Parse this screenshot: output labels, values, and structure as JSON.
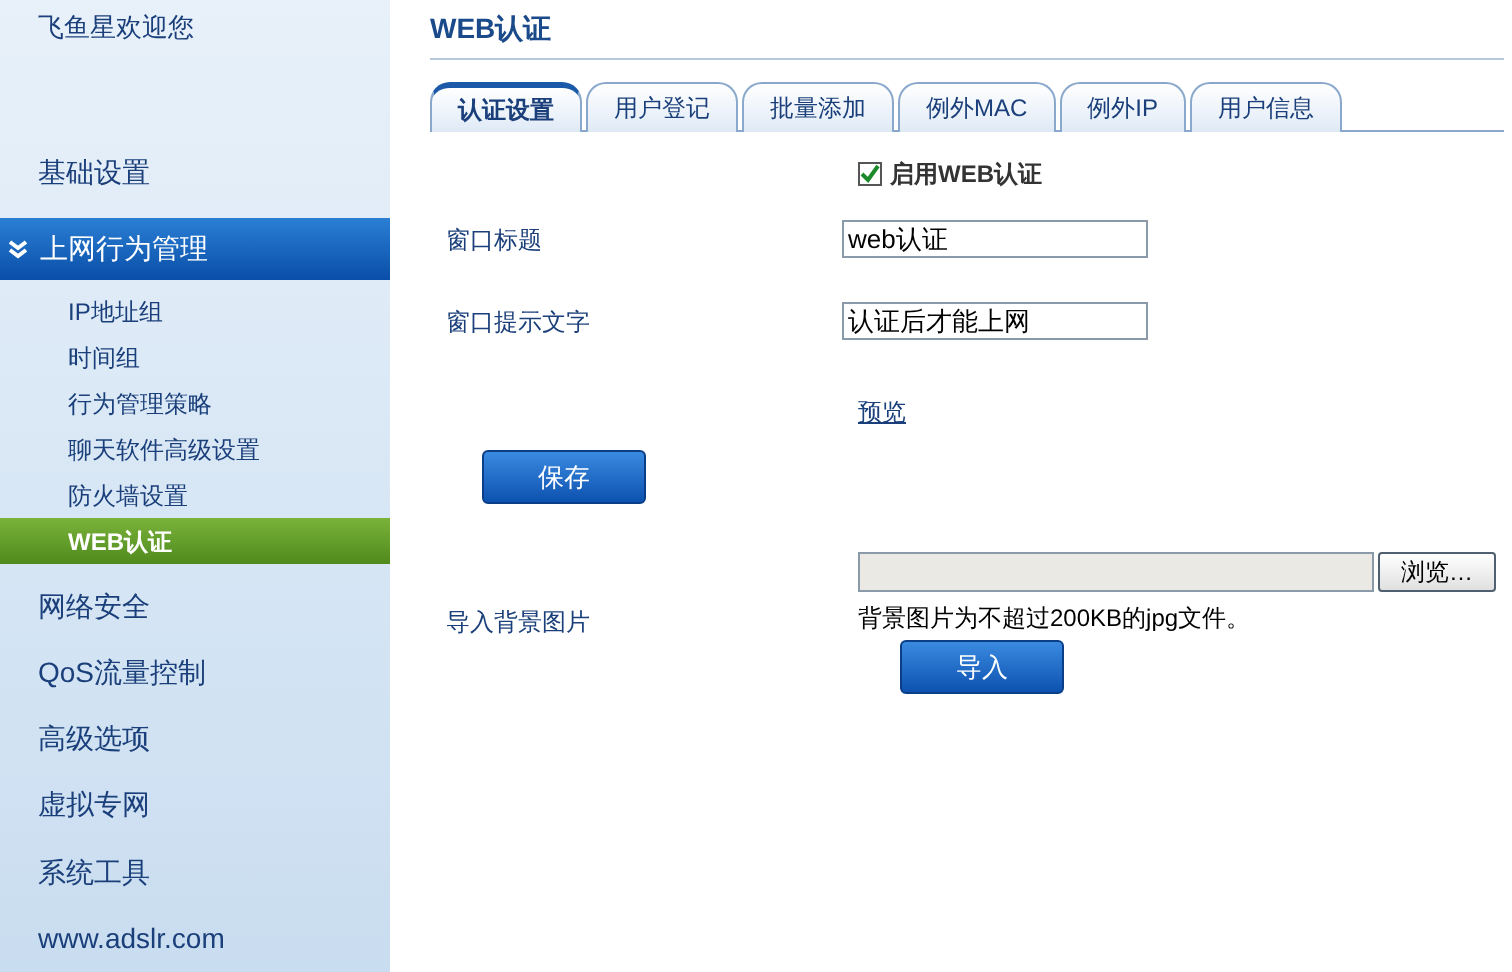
{
  "sidebar": {
    "greeting": "飞鱼星欢迎您",
    "items": [
      {
        "label": "基础设置",
        "expanded": false
      },
      {
        "label": "上网行为管理",
        "expanded": true,
        "children": [
          {
            "label": "IP地址组",
            "selected": false
          },
          {
            "label": "时间组",
            "selected": false
          },
          {
            "label": "行为管理策略",
            "selected": false
          },
          {
            "label": "聊天软件高级设置",
            "selected": false
          },
          {
            "label": "防火墙设置",
            "selected": false
          },
          {
            "label": "WEB认证",
            "selected": true
          }
        ]
      },
      {
        "label": "网络安全",
        "expanded": false
      },
      {
        "label": "QoS流量控制",
        "expanded": false
      },
      {
        "label": "高级选项",
        "expanded": false
      },
      {
        "label": "虚拟专网",
        "expanded": false
      },
      {
        "label": "系统工具",
        "expanded": false
      },
      {
        "label": "www.adslr.com",
        "expanded": false
      }
    ]
  },
  "page_title": "WEB认证",
  "tabs": [
    {
      "label": "认证设置",
      "selected": true
    },
    {
      "label": "用户登记",
      "selected": false
    },
    {
      "label": "批量添加",
      "selected": false
    },
    {
      "label": "例外MAC",
      "selected": false
    },
    {
      "label": "例外IP",
      "selected": false
    },
    {
      "label": "用户信息",
      "selected": false
    }
  ],
  "enable": {
    "label": "启用WEB认证",
    "checked": true
  },
  "fields": [
    {
      "label": "窗口标题",
      "value": "web认证"
    },
    {
      "label": "窗口提示文字",
      "value": "认证后才能上网"
    }
  ],
  "preview_link": "预览",
  "save_button": "保存",
  "import": {
    "label": "导入背景图片",
    "browse_button": "浏览…",
    "hint": "背景图片为不超过200KB的jpg文件。",
    "import_button": "导入"
  }
}
